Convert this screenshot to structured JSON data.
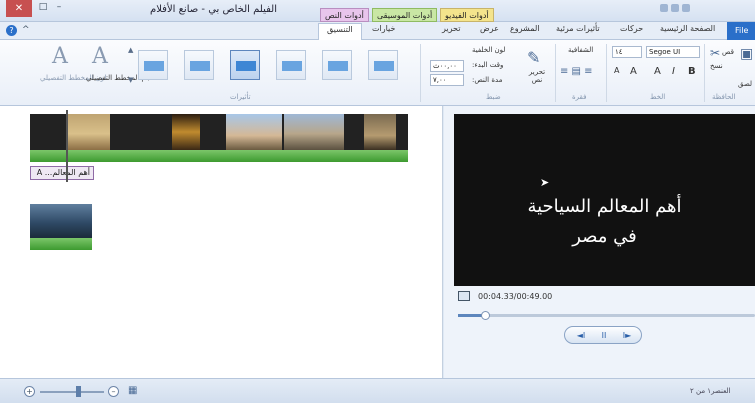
{
  "window": {
    "title": "الفيلم الخاص بي - صانع الأفلام",
    "close_glyph": "✕"
  },
  "context_tabs": {
    "video_tools": "أدوات الفيديو",
    "music_tools": "أدوات الموسيقى",
    "text_tools": "أدوات النص"
  },
  "ribbon_tabs": {
    "file": "File",
    "home": "الصفحة الرئيسية",
    "animations": "حركات",
    "visual_effects": "تأثيرات مرئية",
    "project": "المشروع",
    "view": "عرض",
    "edit": "تحرير",
    "options": "خيارات",
    "format": "التنسيق"
  },
  "ribbon": {
    "clipboard": {
      "paste": "لصق",
      "cut": "قص",
      "copy": "نسخ",
      "group_label": "الحافظة"
    },
    "font": {
      "family": "Segoe UI",
      "size": "١٤",
      "group_label": "الخط",
      "grow": "A",
      "shrink": "A",
      "bold": "B",
      "italic": "I"
    },
    "paragraph": {
      "transparency": "الشفافية",
      "group_label": "فقرة"
    },
    "adjust": {
      "background_color": "لون الخلفية",
      "start_time": "وقت البدء:",
      "start_value": "٠٠,٠٠ث",
      "duration": "مدة النص:",
      "duration_value": "٧,٠٠",
      "edit_text": "تحرير نص",
      "group_label": "ضبط"
    },
    "effects": {
      "group_label": "تأثيرات",
      "outline_size": "حجم المخطط التفصيلي",
      "outline_color": "لون المخطط التفصيلي"
    }
  },
  "storyboard": {
    "caption": "أهم المعالم... A"
  },
  "preview": {
    "overlay_line1": "أهم المعالم السياحية",
    "overlay_line2": "في مصر",
    "time": "00:04.33/00:49.00",
    "progress_fraction": 0.09,
    "prev": "◄I",
    "play": "II",
    "next": "I►"
  },
  "status": {
    "item_count": "العنصر١ من ٢"
  },
  "colors": {
    "accent": "#2a6fc9",
    "video_tools_tab": "#f4e48c",
    "music_tools_tab": "#c9e7a4",
    "text_tools_tab": "#e8c5ec"
  }
}
